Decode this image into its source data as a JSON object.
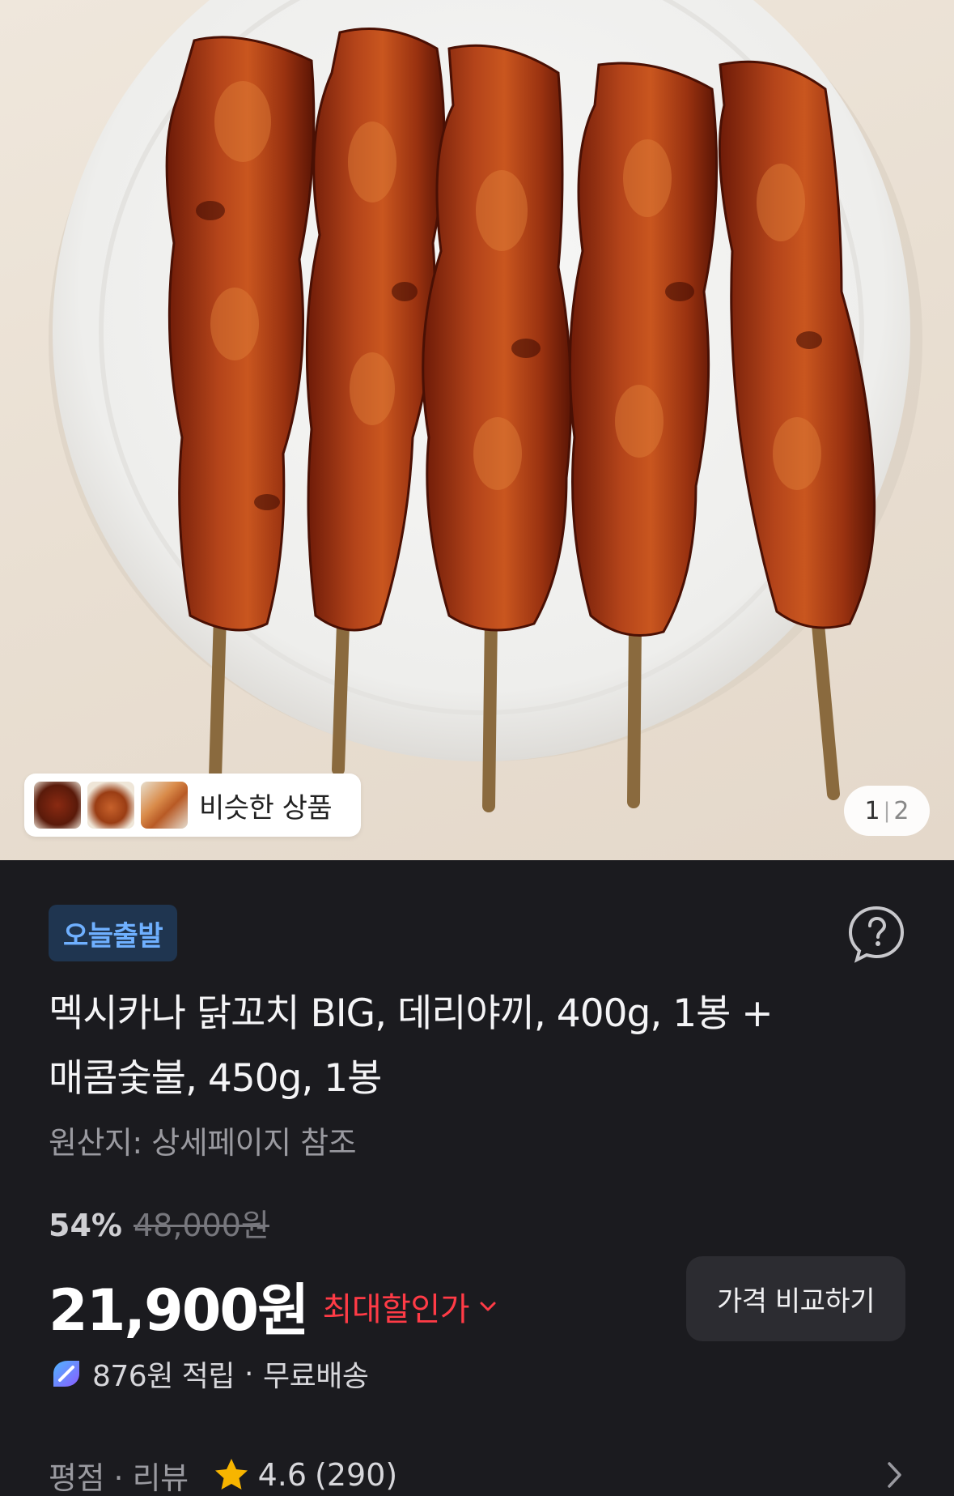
{
  "hero": {
    "similar_label": "비슷한 상품",
    "pager_current": "1",
    "pager_total": "2"
  },
  "product": {
    "badge": "오늘출발",
    "title_line1": "멕시카나 닭꼬치 BIG, 데리야끼, 400g, 1봉 +",
    "title_line2": "매콤숯불, 450g, 1봉",
    "origin": "원산지: 상세페이지 참조"
  },
  "pricing": {
    "discount_percent": "54%",
    "original_price": "48,000원",
    "price": "21,900원",
    "max_discount_label": "최대할인가",
    "compare_button": "가격 비교하기"
  },
  "benefits": {
    "points_text": "876원 적립",
    "separator": "·",
    "shipping_text": "무료배송"
  },
  "rating": {
    "label": "평점 · 리뷰",
    "score": "4.6",
    "count": "(290)"
  },
  "colors": {
    "background": "#1b1b1f",
    "badge_bg": "#1f3550",
    "badge_text": "#6fb0ff",
    "discount_red": "#ff3b46",
    "star": "#f7b500"
  },
  "icons": {
    "help": "help-bubble-icon",
    "chevron_down": "chevron-down-icon",
    "points": "points-icon",
    "star": "star-icon",
    "chevron_right": "chevron-right-icon"
  }
}
